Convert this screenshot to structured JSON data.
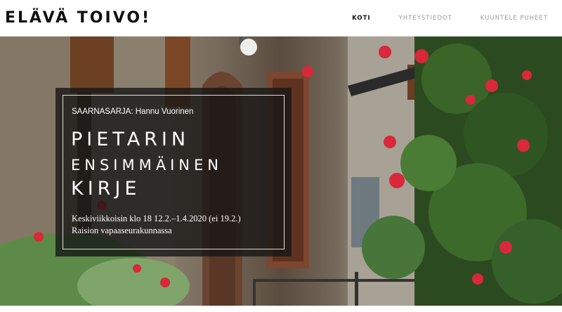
{
  "site": {
    "logo": "ELÄVÄ TOIVO!"
  },
  "nav": {
    "items": [
      {
        "label": "KOTI",
        "active": true
      },
      {
        "label": "YHTEYSTIEDOT",
        "active": false
      },
      {
        "label": "KUUNTELE PUHEET",
        "active": false
      }
    ]
  },
  "hero": {
    "series": "SAARNASARJA: Hannu Vuorinen",
    "title_lines": [
      "PIETARIN",
      "ENSIMMÄINEN",
      "KIRJE"
    ],
    "description": "Keskiviikkoisin klo 18 12.2.–1.4.2020 (ei 19.2.) Raision vapaaseurakunnassa"
  },
  "colors": {
    "header_bg": "#ffffff",
    "nav_active": "#111111",
    "nav_inactive": "#9a9a9a",
    "overlay_bg": "rgba(20,20,20,0.78)",
    "flower_red": "#d8283a"
  }
}
